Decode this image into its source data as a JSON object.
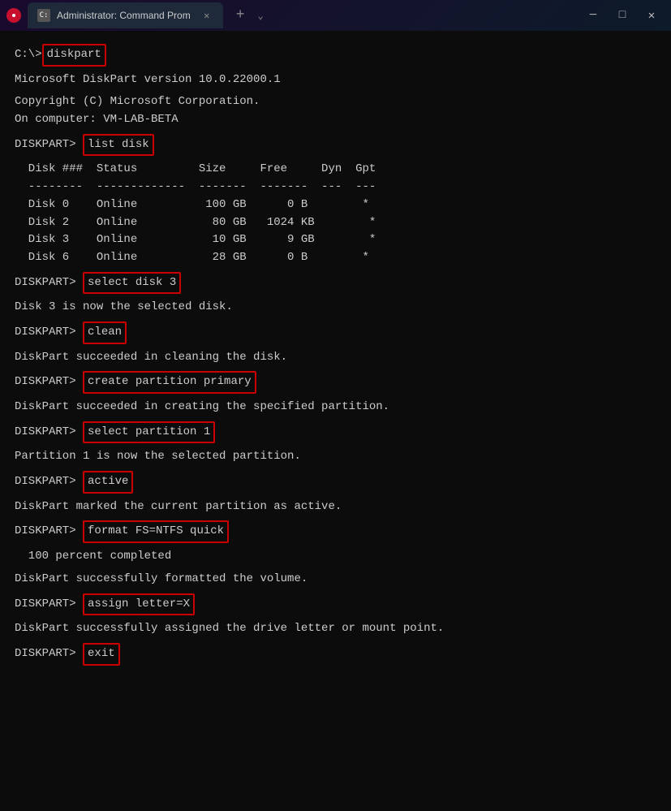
{
  "titlebar": {
    "app_icon_color": "#c8102e",
    "tab_label": "Administrator: Command Prom",
    "add_button": "+",
    "dropdown_arrow": "⌄",
    "minimize": "─",
    "maximize": "□",
    "close": "✕"
  },
  "terminal": {
    "initial_prompt": "C:\\>diskpart",
    "lines": [
      "",
      "Microsoft DiskPart version 10.0.22000.1",
      "",
      "Copyright (C) Microsoft Corporation.",
      "On computer: VM-LAB-BETA",
      "",
      "DISKPART> list disk",
      "",
      "  Disk ###  Status         Size     Free     Dyn  Gpt",
      "  --------  -------------  -------  -------  ---  ---",
      "  Disk 0    Online          100 GB      0 B        *",
      "  Disk 2    Online           80 GB   1024 KB        *",
      "  Disk 3    Online           10 GB      9 GB        *",
      "  Disk 6    Online           28 GB      0 B        *",
      "",
      "DISKPART> select disk 3",
      "",
      "Disk 3 is now the selected disk.",
      "",
      "DISKPART> clean",
      "",
      "DiskPart succeeded in cleaning the disk.",
      "",
      "DISKPART> create partition primary",
      "",
      "DiskPart succeeded in creating the specified partition.",
      "",
      "DISKPART> select partition 1",
      "",
      "Partition 1 is now the selected partition.",
      "",
      "DISKPART> active",
      "",
      "DiskPart marked the current partition as active.",
      "",
      "DISKPART> format FS=NTFS quick",
      "",
      "  100 percent completed",
      "",
      "DiskPart successfully formatted the volume.",
      "",
      "DISKPART> assign letter=X",
      "",
      "DiskPart successfully assigned the drive letter or mount point.",
      "",
      "DISKPART> exit"
    ],
    "highlighted_commands": {
      "diskpart": "diskpart",
      "list_disk": "list disk",
      "select_disk_3": "select disk 3",
      "clean": "clean",
      "create_partition_primary": "create partition primary",
      "select_partition_1": "select partition 1",
      "active": "active",
      "format": "format FS=NTFS quick",
      "assign": "assign letter=X",
      "exit": "exit"
    }
  }
}
